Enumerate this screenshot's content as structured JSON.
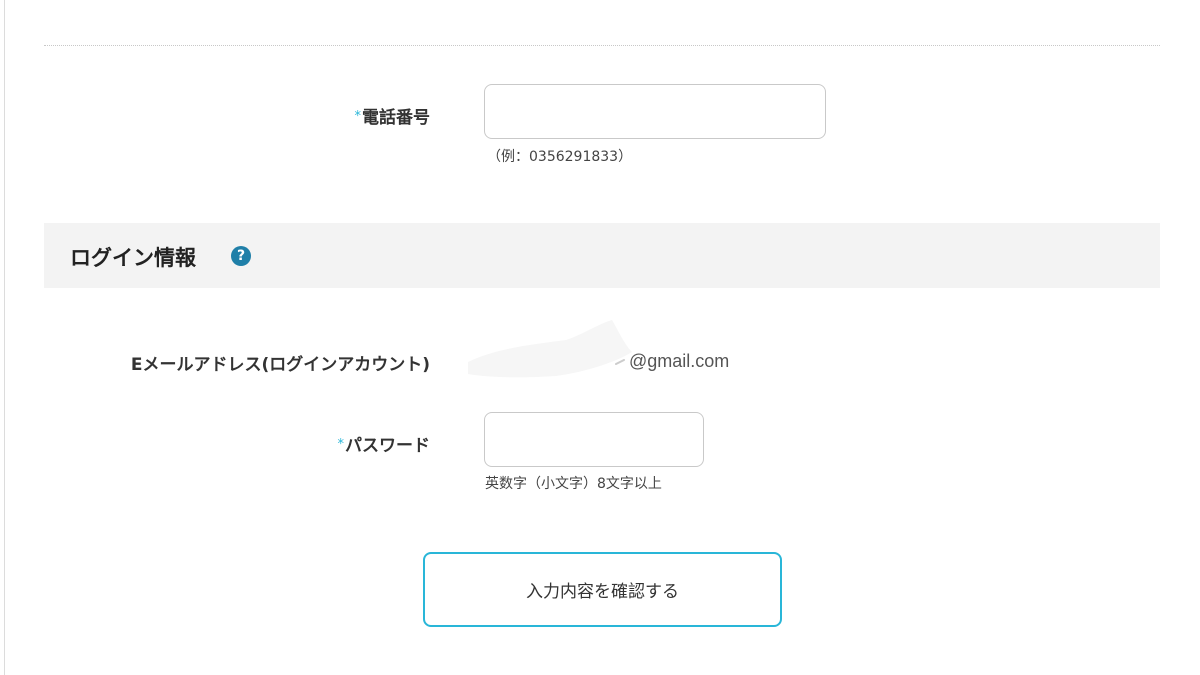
{
  "phone": {
    "required_mark": "*",
    "label": "電話番号",
    "value": "",
    "hint": "（例：0356291833）"
  },
  "login_section": {
    "title": "ログイン情報",
    "help_icon": "?",
    "icon_name": "help-circle-icon",
    "icon_color": "#1f7fa8"
  },
  "email": {
    "label": "Eメールアドレス(ログインアカウント)",
    "value": "@gmail.com"
  },
  "password": {
    "required_mark": "*",
    "label": "パスワード",
    "value": "",
    "hint": "英数字（小文字）8文字以上"
  },
  "confirm_button": {
    "label": "入力内容を確認する"
  },
  "colors": {
    "accent": "#29b6d8",
    "section_bg": "#f3f3f3"
  }
}
